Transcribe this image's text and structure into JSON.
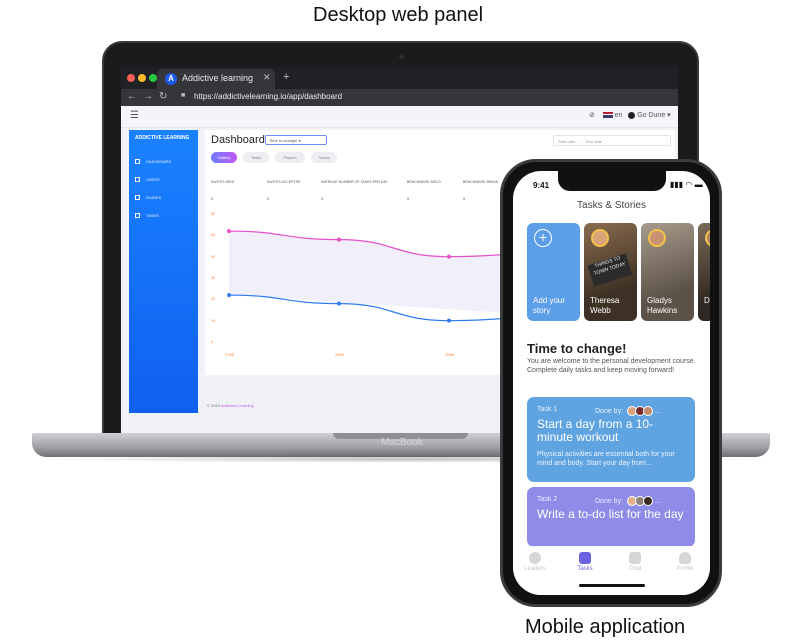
{
  "captions": {
    "top": "Desktop web panel",
    "bottom": "Mobile application"
  },
  "laptop": {
    "brand": "MacBook"
  },
  "browser": {
    "tab_title": "Addictive learning",
    "tab_icon_letter": "A",
    "url": "https://addictivelearning.io/app/dashboard"
  },
  "web": {
    "header": {
      "lang": "en",
      "user": "Go Dune"
    },
    "sidebar": {
      "brand": "ADDICTIVE LEARNING",
      "items": [
        {
          "label": "DASHBOARD",
          "icon": "dashboard-icon"
        },
        {
          "label": "USERS",
          "icon": "users-icon"
        },
        {
          "label": "GUIDES",
          "icon": "guides-icon"
        },
        {
          "label": "TASKS",
          "icon": "tasks-icon"
        }
      ]
    },
    "dashboard": {
      "title": "Dashboard",
      "time_select": "Time to change!",
      "date_start_placeholder": "Start date",
      "date_end_placeholder": "End date",
      "tabs": [
        "Gallery",
        "Tasks",
        "Players",
        "Teams"
      ],
      "columns": [
        "INVITES SENT",
        "INVITES ACCEPTED",
        "AVERAGE NUMBER OF TASKS PER DAY",
        "BENCHMARK BOILD",
        "BENCHMARK BREAK"
      ],
      "values": [
        "0",
        "0",
        "0",
        "0",
        "0"
      ]
    },
    "footer": {
      "prefix": "© 2020",
      "brand": "Addictive Learning"
    }
  },
  "chart_data": {
    "type": "line",
    "x": [
      "27/08",
      "28/08",
      "29/08",
      "30/08"
    ],
    "y_ticks": [
      "60",
      "50",
      "40",
      "30",
      "20",
      "10",
      "0"
    ],
    "ylim": [
      0,
      60
    ],
    "grid": false,
    "series": [
      {
        "values": [
          52,
          48,
          40,
          42
        ],
        "color": "#e84fc8"
      },
      {
        "values": [
          22,
          18,
          10,
          12
        ],
        "color": "#2f7cf0"
      }
    ]
  },
  "mobile": {
    "status_time": "9:41",
    "title": "Tasks & Stories",
    "stories": [
      {
        "label": "Add your story"
      },
      {
        "label": "Theresa Webb",
        "chalk_text": "THINGS TO TOWN TODAY"
      },
      {
        "label": "Gladys Hawkins"
      },
      {
        "label": "D R"
      }
    ],
    "section_title": "Time to change!",
    "section_desc": "You are welcome to the personal development course. Complete daily tasks and keep moving forward!",
    "tasks": [
      {
        "num": "Task 1",
        "done_by": "Done by:",
        "more": "...",
        "title": "Start a day from a 10-minute workout",
        "desc": "Physical activities are essential both for your mind and body. Start your day from..."
      },
      {
        "num": "Task 2",
        "done_by": "Done by:",
        "more": "...",
        "title": "Write a to-do list for the day",
        "desc": ""
      }
    ],
    "nav": [
      {
        "label": "Leaders",
        "icon": "leaders-icon"
      },
      {
        "label": "Tasks",
        "icon": "tasks-grid-icon",
        "active": true
      },
      {
        "label": "Chat",
        "icon": "chat-icon"
      },
      {
        "label": "Profile",
        "icon": "profile-icon"
      }
    ]
  }
}
